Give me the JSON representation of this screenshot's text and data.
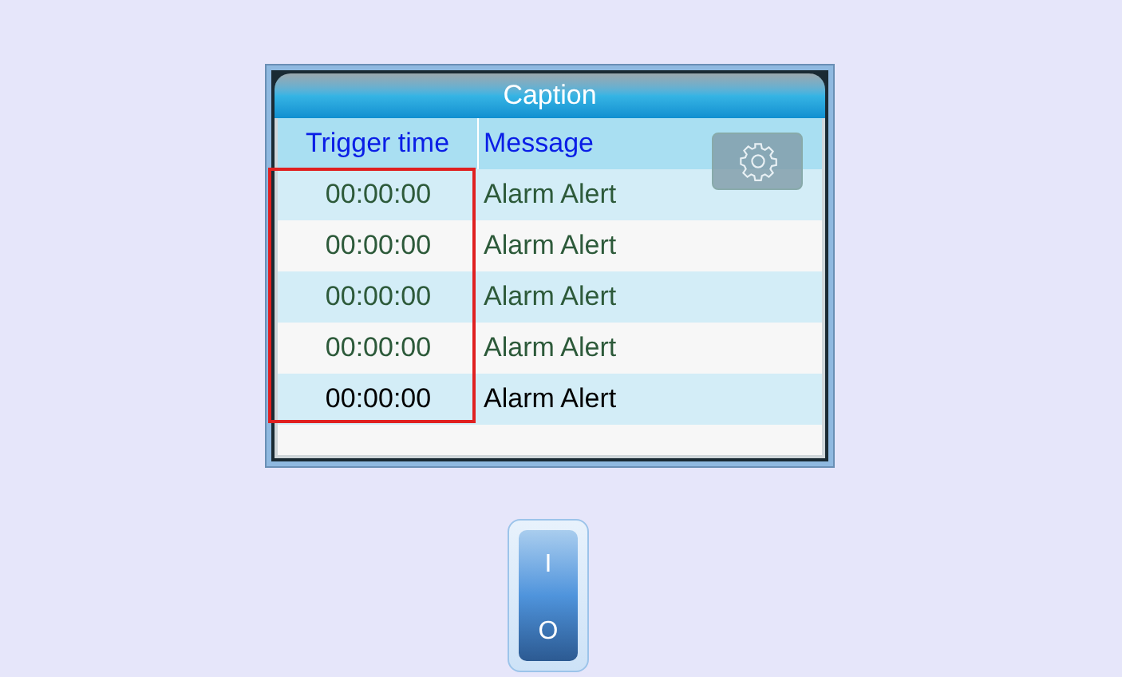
{
  "window": {
    "title": "Caption"
  },
  "table": {
    "columns": [
      "Trigger time",
      "Message"
    ],
    "rows": [
      {
        "time": "00:00:00",
        "message": "Alarm Alert",
        "selected": false
      },
      {
        "time": "00:00:00",
        "message": "Alarm Alert",
        "selected": false
      },
      {
        "time": "00:00:00",
        "message": "Alarm Alert",
        "selected": false
      },
      {
        "time": "00:00:00",
        "message": "Alarm Alert",
        "selected": false
      },
      {
        "time": "00:00:00",
        "message": "Alarm Alert",
        "selected": true
      }
    ]
  },
  "switch": {
    "on_label": "I",
    "off_label": "O",
    "on": false
  }
}
